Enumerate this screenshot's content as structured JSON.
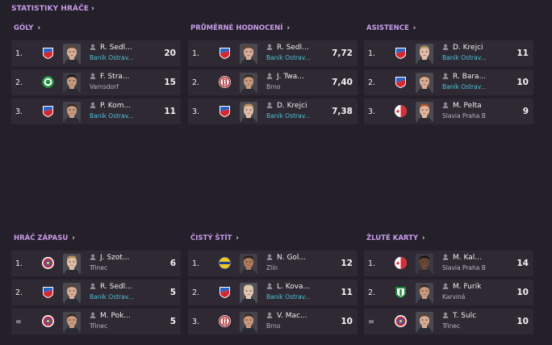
{
  "header": {
    "title": "STATISTIKY HRÁČE"
  },
  "panels": [
    {
      "title": "GÓLY",
      "rows": [
        {
          "rank": "1.",
          "name": "R. Sedl...",
          "club": "Baník Ostrav...",
          "club_link": true,
          "value": "20",
          "badge": "banik",
          "face": "light"
        },
        {
          "rank": "2.",
          "name": "F. Stra...",
          "club": "Varnsdorf",
          "club_link": false,
          "value": "15",
          "badge": "varnsdorf",
          "face": "dark"
        },
        {
          "rank": "3.",
          "name": "P. Kom...",
          "club": "Baník Ostrav...",
          "club_link": true,
          "value": "11",
          "badge": "banik",
          "face": "medium"
        }
      ]
    },
    {
      "title": "PRŮMĚRNÉ HODNOCENÍ",
      "rows": [
        {
          "rank": "1.",
          "name": "R. Sedl...",
          "club": "Baník Ostrav...",
          "club_link": true,
          "value": "7,72",
          "badge": "banik",
          "face": "light"
        },
        {
          "rank": "2.",
          "name": "J. Twa...",
          "club": "Brno",
          "club_link": false,
          "value": "7,40",
          "badge": "brno",
          "face": "medium"
        },
        {
          "rank": "3.",
          "name": "D. Krejci",
          "club": "Baník Ostrav...",
          "club_link": true,
          "value": "7,38",
          "badge": "banik",
          "face": "fair"
        }
      ]
    },
    {
      "title": "ASISTENCE",
      "rows": [
        {
          "rank": "1.",
          "name": "D. Krejci",
          "club": "Baník Ostrav...",
          "club_link": true,
          "value": "11",
          "badge": "banik",
          "face": "fair"
        },
        {
          "rank": "2.",
          "name": "R. Bara...",
          "club": "Baník Ostrav...",
          "club_link": true,
          "value": "10",
          "badge": "banik",
          "face": "light"
        },
        {
          "rank": "3.",
          "name": "M. Pelta",
          "club": "Slavia Praha B",
          "club_link": false,
          "value": "9",
          "badge": "slavia",
          "face": "ginger"
        }
      ]
    },
    {
      "title": "HRÁČ ZÁPASU",
      "rows": [
        {
          "rank": "1.",
          "name": "J. Szot...",
          "club": "Třinec",
          "club_link": false,
          "value": "6",
          "badge": "trinec",
          "face": "fair"
        },
        {
          "rank": "2.",
          "name": "R. Sedl...",
          "club": "Baník Ostrav...",
          "club_link": true,
          "value": "5",
          "badge": "banik",
          "face": "light"
        },
        {
          "rank": "=",
          "name": "M. Pok...",
          "club": "Třinec",
          "club_link": false,
          "value": "5",
          "badge": "trinec",
          "face": "medium"
        }
      ]
    },
    {
      "title": "ČISTÝ ŠTÍT",
      "rows": [
        {
          "rank": "1.",
          "name": "N. Gol...",
          "club": "Zlín",
          "club_link": false,
          "value": "12",
          "badge": "zlin",
          "face": "tan"
        },
        {
          "rank": "2.",
          "name": "L. Kova...",
          "club": "Baník Ostrav...",
          "club_link": true,
          "value": "11",
          "badge": "banik",
          "face": "blond"
        },
        {
          "rank": "3.",
          "name": "V. Mac...",
          "club": "Brno",
          "club_link": false,
          "value": "10",
          "badge": "brno",
          "face": "medium"
        }
      ]
    },
    {
      "title": "ŽLUTÉ KARTY",
      "rows": [
        {
          "rank": "1.",
          "name": "M. Kal...",
          "club": "Slavia Praha B",
          "club_link": false,
          "value": "14",
          "badge": "slavia",
          "face": "darkskin"
        },
        {
          "rank": "2.",
          "name": "M. Furik",
          "club": "Karviná",
          "club_link": false,
          "value": "10",
          "badge": "karvina",
          "face": "medium"
        },
        {
          "rank": "=",
          "name": "T. Sulc",
          "club": "Třinec",
          "club_link": false,
          "value": "10",
          "badge": "trinec",
          "face": "light"
        }
      ]
    }
  ],
  "colors": {
    "background": "#242029",
    "row": "#2e2933",
    "accent": "#c89ce8",
    "link": "#4fc3d9",
    "subtext": "#b9b5bc"
  }
}
